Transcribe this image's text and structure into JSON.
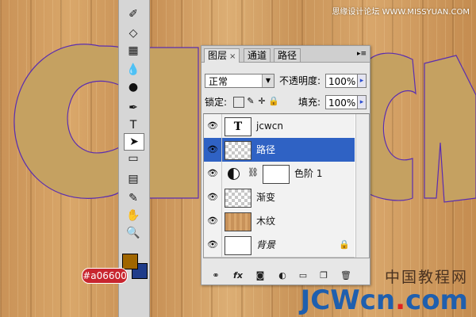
{
  "canvas": {
    "letters": "CWCN",
    "letter_color": "#c5a161",
    "path_color": "#5a2db0"
  },
  "watermark": {
    "top": "思缘设计论坛 WWW.MISSYUAN.COM",
    "bottom_cn": "中国教程网",
    "bottom_en_a": "JCWcn",
    "bottom_en_dot": ".",
    "bottom_en_b": "com"
  },
  "toolbox": {
    "tools": [
      {
        "name": "history-brush-icon",
        "glyph": "✐"
      },
      {
        "name": "eraser-icon",
        "glyph": "◇"
      },
      {
        "name": "gradient-icon",
        "glyph": "▦"
      },
      {
        "name": "blur-icon",
        "glyph": "💧"
      },
      {
        "name": "dodge-icon",
        "glyph": "●"
      },
      {
        "name": "pen-icon",
        "glyph": "✒"
      },
      {
        "name": "type-icon",
        "glyph": "T"
      },
      {
        "name": "path-selection-icon",
        "glyph": "➤"
      },
      {
        "name": "shape-icon",
        "glyph": "▭"
      },
      {
        "name": "notes-icon",
        "glyph": "▤"
      },
      {
        "name": "eyedropper-icon",
        "glyph": "✎"
      },
      {
        "name": "hand-icon",
        "glyph": "✋"
      },
      {
        "name": "zoom-icon",
        "glyph": "🔍"
      }
    ],
    "foreground_color": "#a06600",
    "background_color": "#1f3c8a",
    "color_tag": "#a06600"
  },
  "panel": {
    "tabs": [
      {
        "label": "图层",
        "close": "×"
      },
      {
        "label": "通道"
      },
      {
        "label": "路径"
      }
    ],
    "menu_glyph": "▸≡",
    "blend_mode": "正常",
    "opacity_label": "不透明度:",
    "opacity_value": "100%",
    "lock_label": "锁定:",
    "fill_label": "填充:",
    "fill_value": "100%",
    "spin_glyph": "▸",
    "layers": [
      {
        "name": "jcwcn",
        "thumb": "T"
      },
      {
        "name": "路径"
      },
      {
        "name": "色阶 1"
      },
      {
        "name": "渐变"
      },
      {
        "name": "木纹"
      },
      {
        "name": "背景"
      }
    ],
    "eye_glyph": "👁"
  }
}
